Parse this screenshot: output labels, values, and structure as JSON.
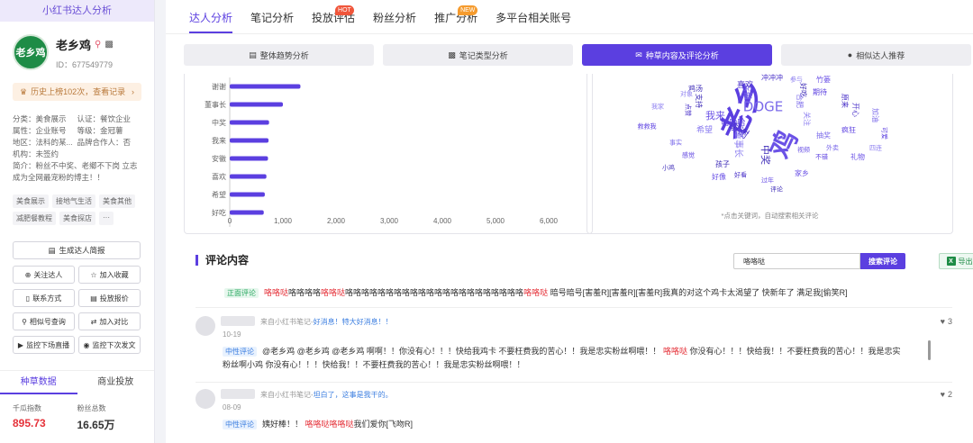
{
  "sidebar": {
    "header": "小红书达人分析",
    "avatar_text": "老乡鸡",
    "name": "老乡鸡",
    "id": "ID：677549779",
    "history": {
      "text": "历史上榜102次，查看记录",
      "arrow": "›"
    },
    "meta": [
      [
        "分类：美食展示",
        "认证：餐饮企业"
      ],
      [
        "属性：企业账号",
        "等级：金冠薯"
      ],
      [
        "地区：法科的某...",
        "品牌合作人：否"
      ],
      [
        "机构：未签约",
        ""
      ]
    ],
    "intro": "简介：粉丝不中奖、老鄉不下岗 立志成为全网最宠粉的博主！！",
    "tags": [
      "美食展示",
      "接地气生活",
      "美食其他",
      "减肥餐教程",
      "美食探店",
      "···"
    ],
    "btn_report": "生成达人简报",
    "buttons": [
      "关注达人",
      "加入收藏",
      "联系方式",
      "投放报价",
      "相似号查询",
      "加入对比",
      "监控下场直播",
      "监控下次发文"
    ],
    "tabs": [
      "种草数据",
      "商业投放"
    ],
    "stats": [
      {
        "label": "千瓜指数",
        "value": "895.73"
      },
      {
        "label": "粉丝总数",
        "value": "16.65万"
      }
    ]
  },
  "nav": {
    "items": [
      "达人分析",
      "笔记分析",
      "投放评估",
      "粉丝分析",
      "推广分析",
      "多平台相关账号"
    ],
    "hot": "HOT",
    "new": "NEW"
  },
  "subtabs": [
    "整体趋势分析",
    "笔记类型分析",
    "种草内容及评论分析",
    "相似达人推荐"
  ],
  "chart_data": {
    "type": "bar",
    "orientation": "horizontal",
    "categories": [
      "谢谢",
      "董事长",
      "中奖",
      "我来",
      "安徽",
      "喜欢",
      "希望",
      "好吃"
    ],
    "values": [
      1330,
      1000,
      740,
      730,
      720,
      690,
      660,
      640
    ],
    "xticks": [
      "0",
      "1,000",
      "2,000",
      "3,000",
      "4,000",
      "5,000",
      "6,000"
    ],
    "xlim": [
      0,
      6000
    ],
    "color": "#5b3fe0"
  },
  "cloud": {
    "note": "*点击关键词，自动搜索相关评论",
    "words": [
      [
        "老乡",
        34,
        -65
      ],
      [
        "鸡",
        30,
        -65
      ],
      [
        "DOGE",
        15,
        0
      ],
      [
        "谢谢",
        12,
        35
      ],
      [
        "董事长",
        10,
        90
      ],
      [
        "中奖",
        11,
        90
      ],
      [
        "哈哈哈",
        9,
        0
      ],
      [
        "我来",
        11,
        0
      ],
      [
        "安徽",
        9,
        90
      ],
      [
        "喜欢",
        9,
        0
      ],
      [
        "希望",
        9,
        0
      ],
      [
        "好吃",
        8,
        90
      ],
      [
        "疯狂",
        8,
        0
      ],
      [
        "礼物",
        8,
        0
      ],
      [
        "抽奖",
        8,
        0
      ],
      [
        "冲冲冲",
        8,
        0
      ],
      [
        "参与",
        7,
        0
      ],
      [
        "支持",
        8,
        90
      ],
      [
        "期待",
        8,
        0
      ],
      [
        "竹篓",
        8,
        0
      ],
      [
        "合肥",
        8,
        90
      ],
      [
        "点赞",
        7,
        90
      ],
      [
        "关注",
        8,
        90
      ],
      [
        "孩子",
        8,
        0
      ],
      [
        "救救我",
        7,
        0
      ],
      [
        "好像",
        8,
        0
      ],
      [
        "事实",
        7,
        0
      ],
      [
        "原来",
        8,
        90
      ],
      [
        "四连",
        7,
        0
      ],
      [
        "鸡汤",
        8,
        0
      ],
      [
        "不错",
        7,
        0
      ],
      [
        "家乡",
        8,
        0
      ],
      [
        "外卖",
        7,
        0
      ],
      [
        "开心",
        8,
        90
      ],
      [
        "我家",
        7,
        0
      ],
      [
        "小鸡",
        7,
        0
      ],
      [
        "感觉",
        7,
        0
      ],
      [
        "过年",
        7,
        0
      ],
      [
        "加油",
        8,
        90
      ],
      [
        "好看",
        7,
        0
      ],
      [
        "对象",
        7,
        0
      ],
      [
        "评论",
        7,
        0
      ],
      [
        "可爱",
        7,
        90
      ],
      [
        "视频",
        7,
        0
      ]
    ]
  },
  "comments": {
    "title": "评论内容",
    "search_value": "咯咯哒",
    "search_btn": "搜索评论",
    "export": "导出",
    "first": {
      "sentiment": "正面评论",
      "kw": "咯咯哒",
      "mid1": "咯咯咯咯",
      "mid2": "咯咯咯咯咯咯咯咯咯咯咯咯咯咯咯咯咯咯咯咯咯咯",
      "rest": "暗号暗号[害羞R][害羞R][害羞R]我真的对这个鸡卡太渴望了 快新年了 满足我[偷笑R]"
    },
    "items": [
      {
        "from": "来自小红书笔记-",
        "note": "好消息！特大好消息！！",
        "date": "10-19",
        "likes": "3",
        "sentiment": "中性评论",
        "p1": "@老乡鸡 @老乡鸡 @老乡鸡 啊啊！！你没有心！！！快给我鸡卡 不要枉费我的苦心！！我是忠实粉丝啊喂！！",
        "kw": "咯咯哒",
        "p2": "你没有心！！！快给我！！不要枉费我的苦心！！我是忠实粉丝啊小鸡 你没有心！！！快给我！！不要枉费我的苦心！！我是忠实粉丝啊喂！！"
      },
      {
        "from": "来自小红书笔记-",
        "note": "坦白了，这事是我干的。",
        "date": "08-09",
        "likes": "2",
        "sentiment": "中性评论",
        "p1": "姨好棒！！",
        "kw": "咯咯哒咯咯哒",
        "p2": "我们爱你[飞吻R]"
      }
    ]
  }
}
